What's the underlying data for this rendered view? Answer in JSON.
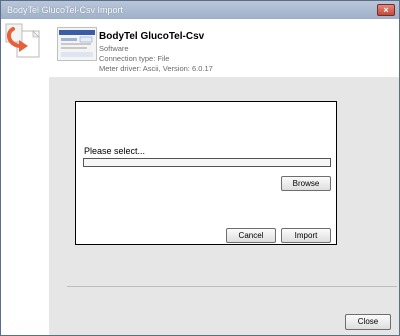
{
  "window": {
    "title": "BodyTel GlucoTel-Csv Import",
    "close_glyph": "×"
  },
  "header": {
    "app_title": "BodyTel GlucoTel-Csv",
    "category": "Software",
    "connection": "Connection type: File",
    "driver": "Meter driver: Ascii, Version: 6.0.17"
  },
  "dialog": {
    "prompt": "Please select...",
    "path_value": "",
    "browse_label": "Browse",
    "cancel_label": "Cancel",
    "import_label": "Import"
  },
  "footer": {
    "close_label": "Close"
  },
  "icons": {
    "app_icon": "file-import-arrow-icon",
    "thumbnail": "software-screenshot-thumbnail"
  },
  "colors": {
    "accent_orange": "#e8603a",
    "title_bar": "#a8b8cf"
  }
}
